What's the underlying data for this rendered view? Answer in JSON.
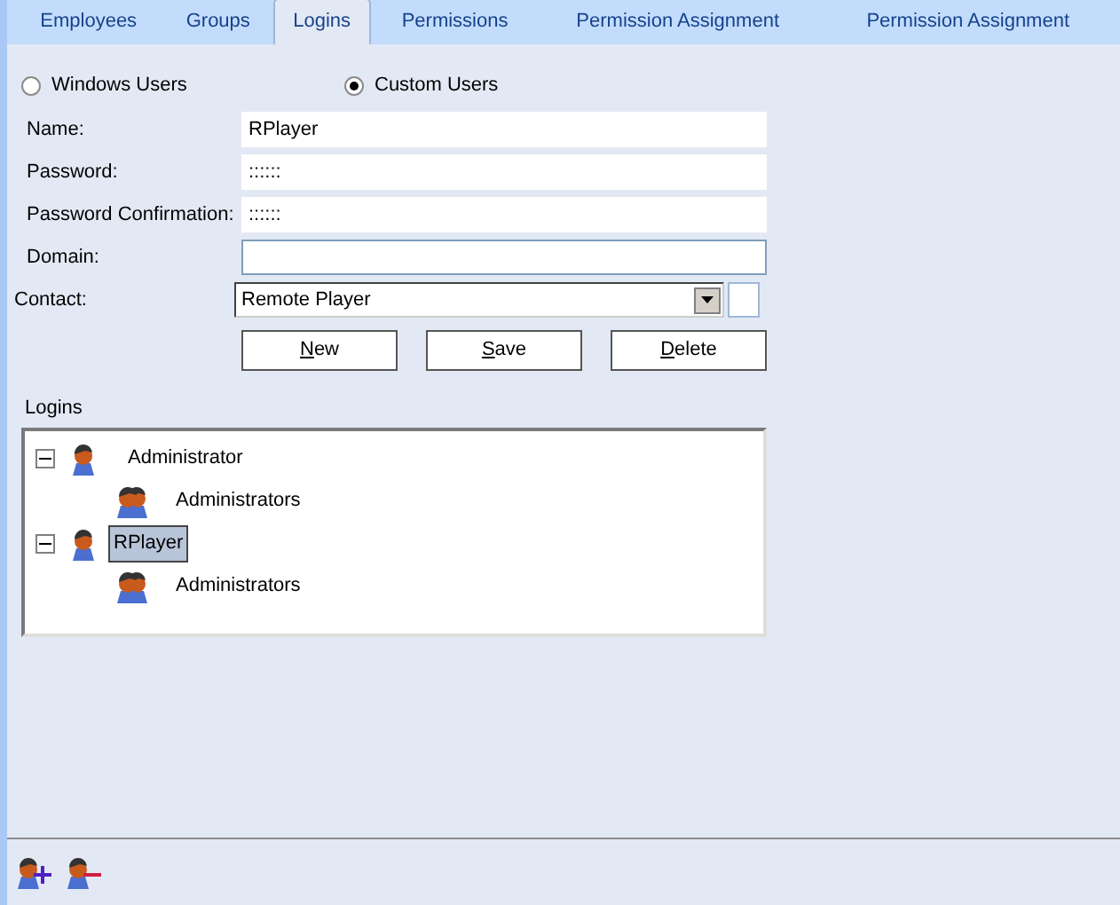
{
  "tabs": [
    {
      "label": "Employees",
      "selected": false
    },
    {
      "label": "Groups",
      "selected": false
    },
    {
      "label": "Logins",
      "selected": true
    },
    {
      "label": "Permissions",
      "selected": false
    },
    {
      "label": "Permission Assignment",
      "selected": false
    },
    {
      "label": "Permission Assignment",
      "selected": false
    }
  ],
  "user_type": [
    {
      "label": "Windows Users",
      "selected": false
    },
    {
      "label": "Custom Users",
      "selected": true
    }
  ],
  "fields": [
    {
      "label": "Name:",
      "value": "RPlayer",
      "kind": "flat"
    },
    {
      "label": "Password:",
      "value": "::::::",
      "kind": "flat"
    },
    {
      "label": "Password Confirmation:",
      "value": "::::::",
      "kind": "flat"
    },
    {
      "label": "Domain:",
      "kind": "boxed"
    },
    {
      "label": "Contact:",
      "value": "Remote Player",
      "kind": "combo"
    }
  ],
  "buttons": [
    {
      "label": "New",
      "first_letter_underlined": true
    },
    {
      "label": "Save",
      "first_letter_underlined": true
    },
    {
      "label": "Delete",
      "first_letter_underlined": true
    }
  ],
  "logins": {
    "title": "Logins",
    "tree": [
      {
        "label": "Administrator",
        "expanded": true,
        "selected": false,
        "children": [
          {
            "label": "Administrators",
            "selected": false
          }
        ]
      },
      {
        "label": "RPlayer",
        "expanded": true,
        "selected": true,
        "children": [
          {
            "label": "Administrators",
            "selected": false
          }
        ]
      }
    ]
  }
}
